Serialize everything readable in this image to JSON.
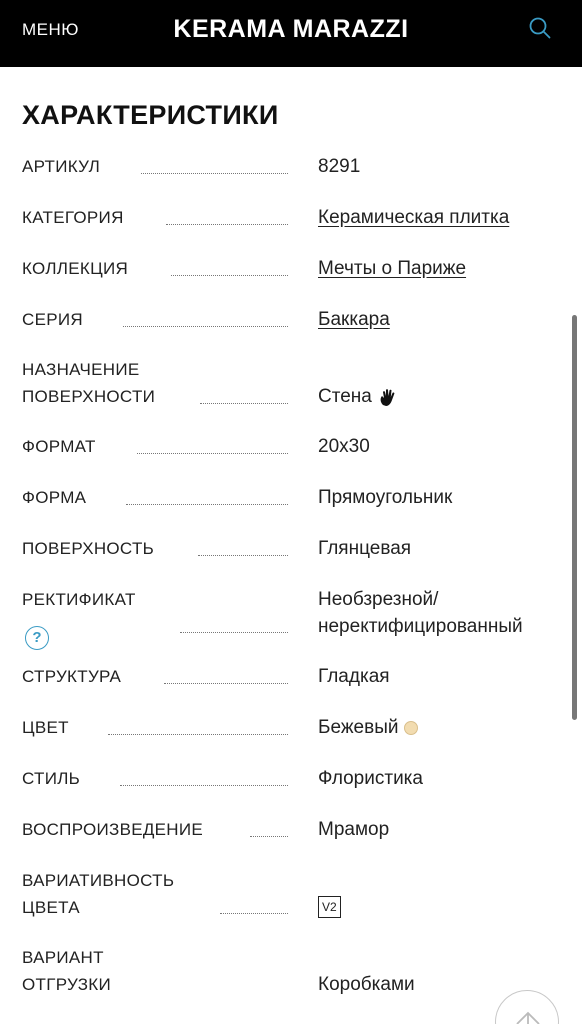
{
  "header": {
    "menu_label": "МЕНЮ",
    "brand": "KERAMA MARAZZI",
    "search_icon": "search-icon"
  },
  "section": {
    "title": "ХАРАКТЕРИСТИКИ"
  },
  "specs": {
    "article": {
      "label": "АРТИКУЛ",
      "value": "8291"
    },
    "category": {
      "label": "КАТЕГОРИЯ",
      "value": "Керамическая плитка"
    },
    "collection": {
      "label": "КОЛЛЕКЦИЯ",
      "value": "Мечты о Париже"
    },
    "series": {
      "label": "СЕРИЯ",
      "value": "Баккара"
    },
    "purpose": {
      "label_line1": "НАЗНАЧЕНИЕ",
      "label_line2": "ПОВЕРХНОСТИ",
      "value": "Стена",
      "icon": "hand-icon"
    },
    "format": {
      "label": "ФОРМАТ",
      "value": "20x30"
    },
    "shape": {
      "label": "ФОРМА",
      "value": "Прямоугольник"
    },
    "surface": {
      "label": "ПОВЕРХНОСТЬ",
      "value": "Глянцевая"
    },
    "rectified": {
      "label": "РЕКТИФИКАТ",
      "help": "?",
      "value_line1": "Необзрезной/",
      "value_line2": "неректифицированный"
    },
    "structure": {
      "label": "СТРУКТУРА",
      "value": "Гладкая"
    },
    "color": {
      "label": "ЦВЕТ",
      "value": "Бежевый",
      "swatch": "#f2dcb0"
    },
    "style": {
      "label": "СТИЛЬ",
      "value": "Флористика"
    },
    "reproduction": {
      "label": "ВОСПРОИЗВЕДЕНИЕ",
      "value": "Мрамор"
    },
    "color_variation": {
      "label_line1": "ВАРИАТИВНОСТЬ",
      "label_line2": "ЦВЕТА",
      "value": "V2"
    },
    "shipping": {
      "label_line1": "ВАРИАНТ",
      "label_line2": "ОТГРУЗКИ",
      "value": "Коробками"
    }
  },
  "controls": {
    "scroll_up_icon": "arrow-up-icon"
  },
  "colors": {
    "header_bg": "#000000",
    "accent": "#3a9bc4",
    "text": "#222222"
  }
}
